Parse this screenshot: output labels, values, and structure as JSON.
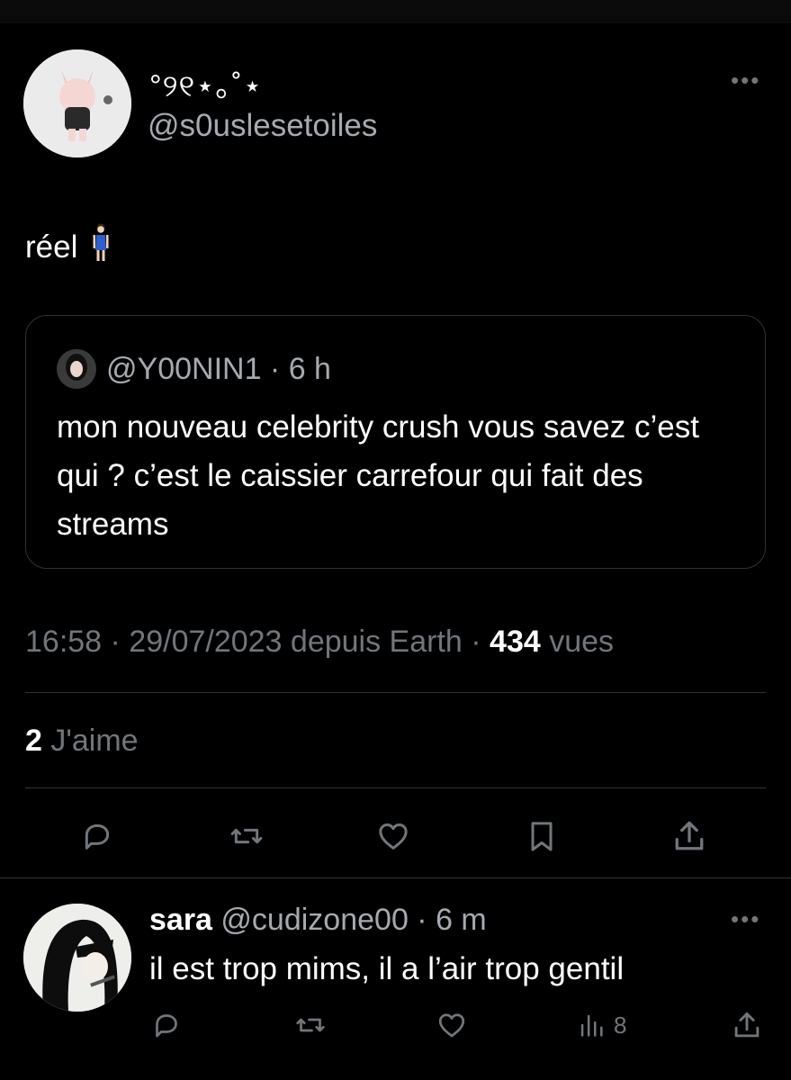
{
  "tweet": {
    "display_name": "°୨୧⋆｡˚⋆",
    "handle": "@s0uslesetoiles",
    "more_label": "•••",
    "text": "réel",
    "text_emoji": "person-standing-icon",
    "quoted": {
      "handle": "@Y00NIN1",
      "time": "6 h",
      "text": "mon nouveau celebrity crush vous savez c’est qui ? c’est le caissier carrefour qui fait des streams"
    },
    "timestamp": "16:58 · 29/07/2023 depuis Earth ·",
    "views": "434",
    "views_label": "vues",
    "likes": "2",
    "likes_label": "J'aime"
  },
  "actions": {
    "icons": [
      "reply-icon",
      "retweet-icon",
      "like-icon",
      "bookmark-icon",
      "share-icon"
    ]
  },
  "reply": {
    "name": "sara",
    "handle": "@cudizone00",
    "time": "6 m",
    "more_label": "•••",
    "text": "il est trop mims, il a l’air trop gentil",
    "views_count": "8"
  },
  "colors": {
    "background": "#000000",
    "text": "#e7e9ea",
    "secondary": "#71767b",
    "border": "#2f3336"
  }
}
